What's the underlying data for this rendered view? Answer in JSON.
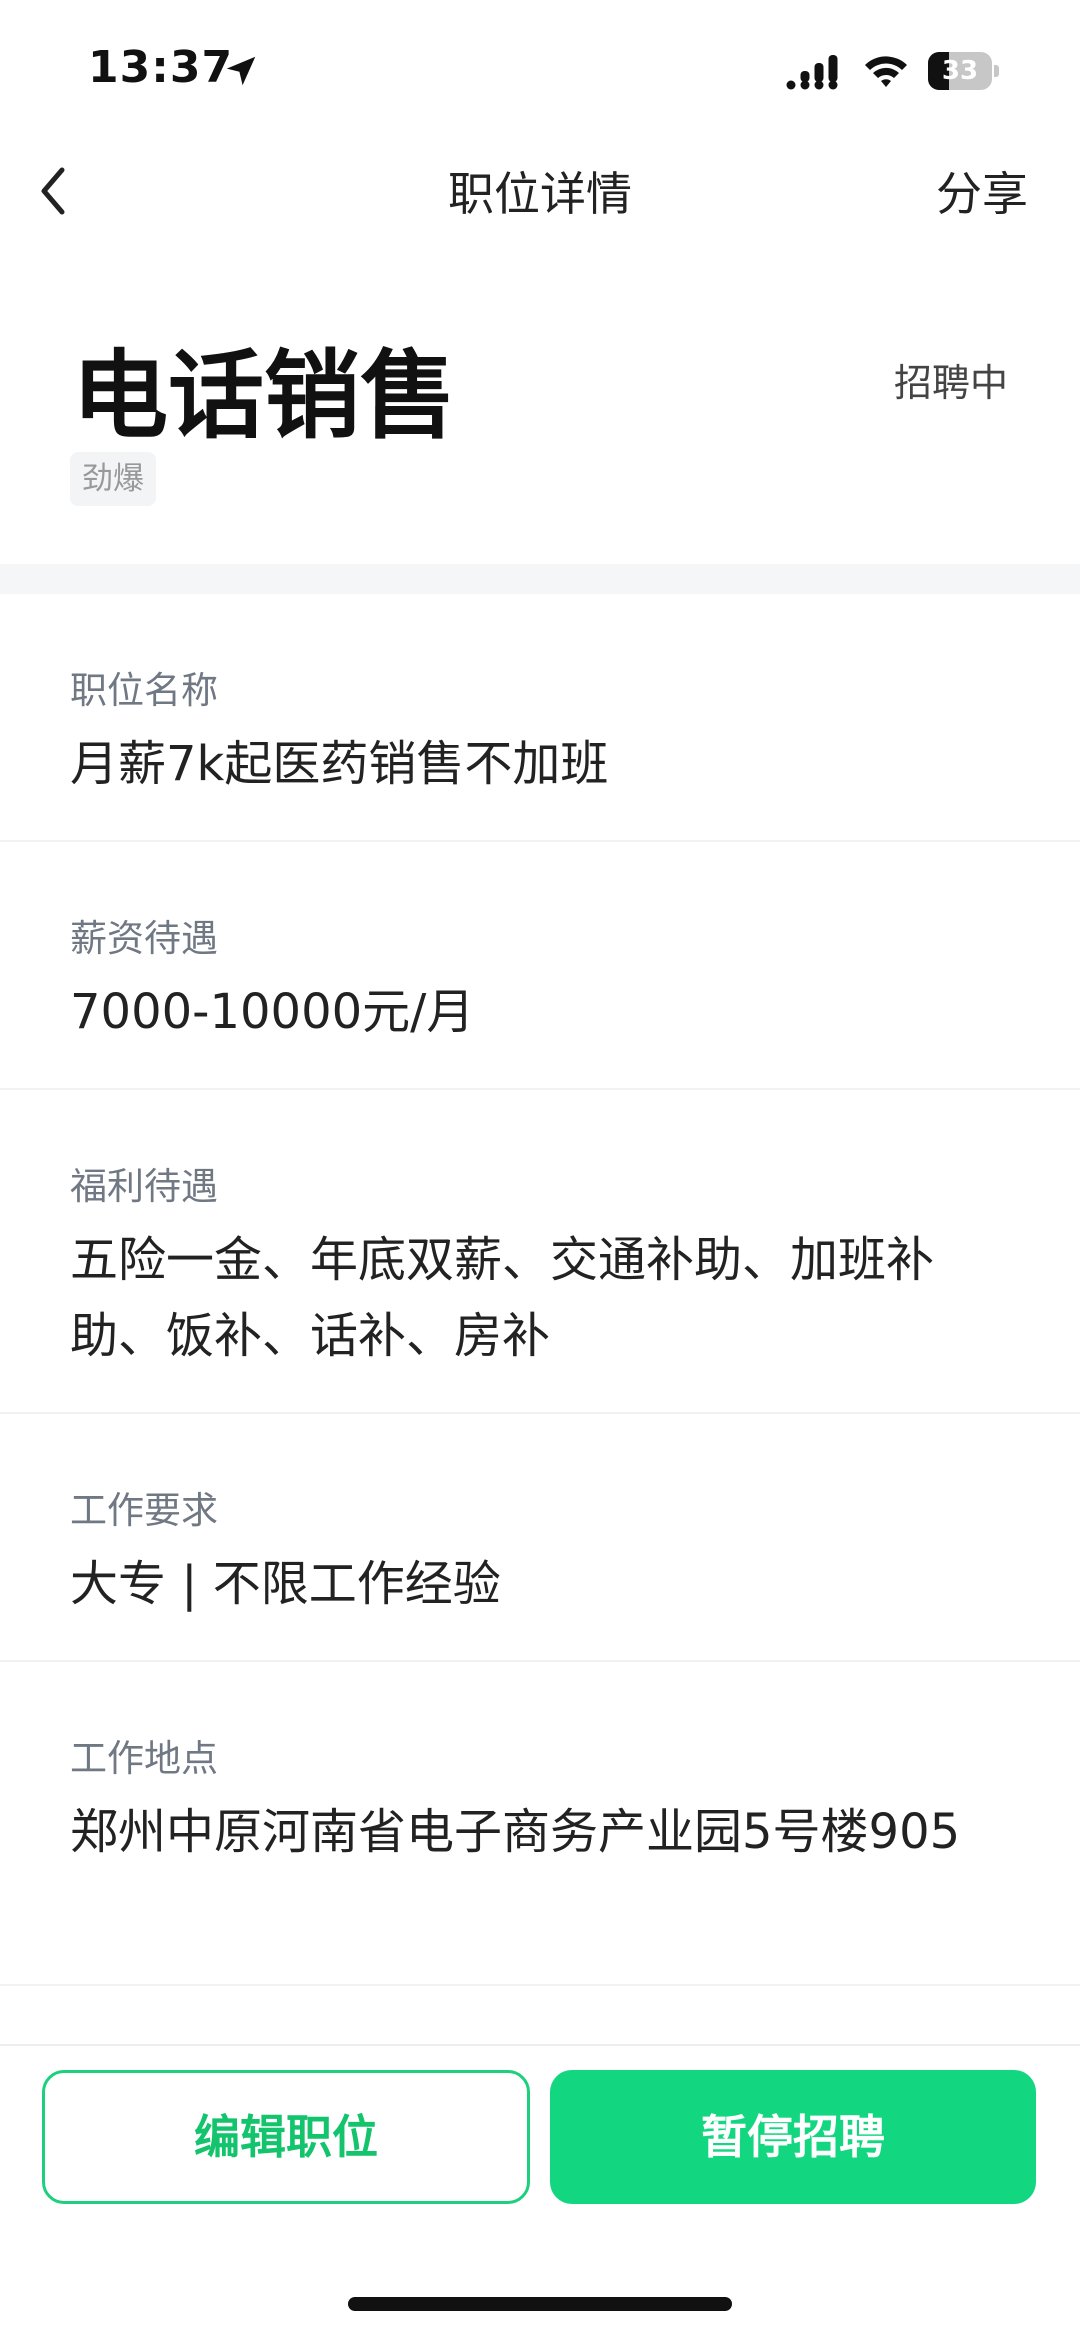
{
  "status_bar": {
    "time": "13:37",
    "battery_level": "33",
    "battery_percent": 33
  },
  "nav": {
    "title": "职位详情",
    "share_label": "分享"
  },
  "header": {
    "job_title": "电话销售",
    "status": "招聘中",
    "tag": "劲爆"
  },
  "sections": [
    {
      "label": "职位名称",
      "value": "月薪7k起医药销售不加班"
    },
    {
      "label": "薪资待遇",
      "value": "7000-10000元/月"
    },
    {
      "label": "福利待遇",
      "value": "五险一金、年底双薪、交通补助、加班补助、饭补、话补、房补"
    },
    {
      "label": "工作要求",
      "value": "大专 | 不限工作经验"
    },
    {
      "label": "工作地点",
      "value": "郑州中原河南省电子商务产业园5号楼905"
    }
  ],
  "actions": {
    "edit_label": "编辑职位",
    "pause_label": "暂停招聘"
  },
  "colors": {
    "accent": "#13d680",
    "accent_text": "#13c46d",
    "label_gray": "#707884"
  },
  "icons": {
    "location": "location-arrow-icon",
    "signal": "signal-icon",
    "wifi": "wifi-icon",
    "battery": "battery-icon",
    "back": "chevron-left-icon"
  }
}
